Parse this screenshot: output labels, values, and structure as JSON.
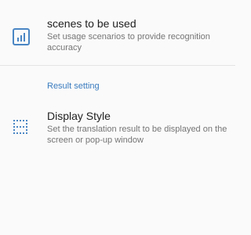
{
  "settings": {
    "scenes": {
      "title": "scenes to be used",
      "subtitle": "Set usage scenarios to provide recognition accuracy",
      "icon": "bar-chart-icon"
    },
    "result_section": {
      "header": "Result setting"
    },
    "display_style": {
      "title": "Display Style",
      "subtitle": "Set the translation result to be displayed on the screen or pop-up window",
      "icon": "dotted-grid-icon"
    }
  },
  "colors": {
    "accent": "#3a7cbf",
    "icon": "#4a86c4",
    "title": "#212121",
    "subtitle": "#757575",
    "background": "#fafafa"
  }
}
